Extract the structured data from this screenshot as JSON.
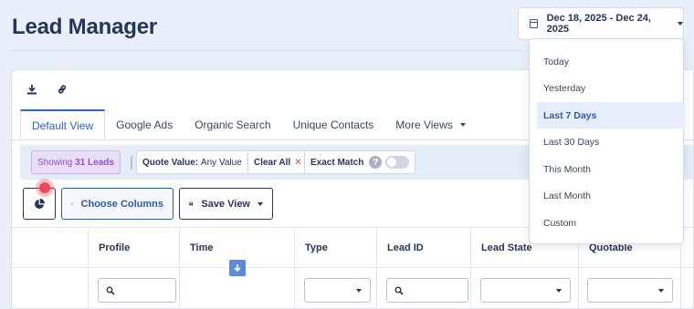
{
  "header": {
    "title": "Lead Manager",
    "date_range": "Dec 18, 2025 - Dec 24, 2025"
  },
  "toolbar_icons": [
    "download-icon",
    "link-icon"
  ],
  "tabs": [
    {
      "label": "Default View"
    },
    {
      "label": "Google Ads"
    },
    {
      "label": "Organic Search"
    },
    {
      "label": "Unique Contacts"
    },
    {
      "label": "More Views"
    }
  ],
  "filters": {
    "showing_prefix": "Showing",
    "showing_count": "31 Leads",
    "quote_label": "Quote Value:",
    "quote_value": "Any Value",
    "quote_close": "✕",
    "clear_all": "Clear All",
    "clear_close": "✕",
    "exact_match": "Exact Match",
    "help": "?"
  },
  "actions": {
    "choose_columns": "Choose Columns",
    "save_view": "Save View"
  },
  "columns": [
    "Profile",
    "Time",
    "Type",
    "Lead ID",
    "Lead State",
    "Quotable"
  ],
  "date_menu": {
    "options": [
      "Today",
      "Yesterday",
      "Last 7 Days",
      "Last 30 Days",
      "This Month",
      "Last Month",
      "Custom"
    ],
    "selected": "Last 7 Days"
  },
  "colors": {
    "accent": "#2d56b8",
    "showing_chip": "#e9ddf8",
    "filter_bar": "#e4ecf8",
    "click_marker": "#ee4a5a"
  }
}
